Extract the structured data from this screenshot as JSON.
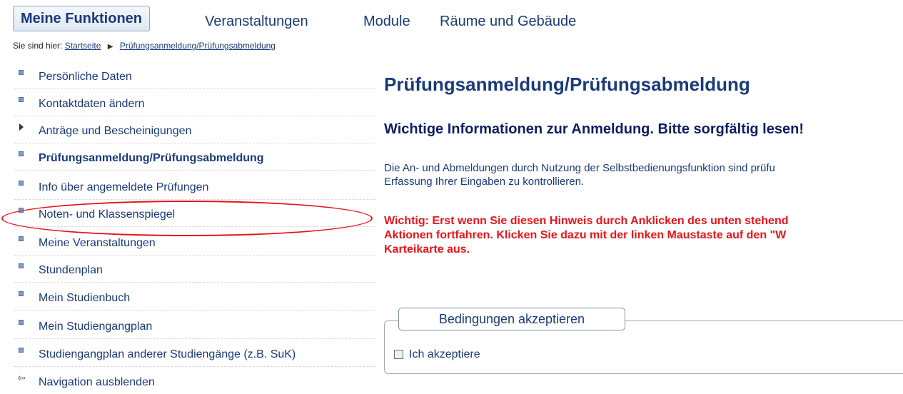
{
  "topnav": {
    "tabs": [
      {
        "label": "Meine Funktionen",
        "active": true
      },
      {
        "label": "Veranstaltungen"
      },
      {
        "label": "Module"
      },
      {
        "label": "Räume und Gebäude"
      }
    ]
  },
  "breadcrumb": {
    "prefix": "Sie sind hier:",
    "items": [
      "Startseite",
      "Prüfungsanmeldung/Prüfungsabmeldung"
    ]
  },
  "sidebar": {
    "items": [
      {
        "label": "Persönliche Daten",
        "icon": "square-bullet-icon"
      },
      {
        "label": "Kontaktdaten ändern",
        "icon": "square-bullet-icon"
      },
      {
        "label": "Anträge und Bescheinigungen",
        "icon": "triangle-right-icon"
      },
      {
        "label": "Prüfungsanmeldung/Prüfungsabmeldung",
        "icon": "square-bullet-icon",
        "active": true
      },
      {
        "label": "Info über angemeldete Prüfungen",
        "icon": "square-bullet-icon"
      },
      {
        "label": "Noten- und Klassenspiegel",
        "icon": "square-bullet-icon"
      },
      {
        "label": "Meine Veranstaltungen",
        "icon": "square-bullet-icon"
      },
      {
        "label": "Stundenplan",
        "icon": "square-bullet-icon"
      },
      {
        "label": "Mein Studienbuch",
        "icon": "square-bullet-icon"
      },
      {
        "label": "Mein Studiengangplan",
        "icon": "square-bullet-icon"
      },
      {
        "label": "Studiengangplan anderer Studiengänge (z.B. SuK)",
        "icon": "square-bullet-icon"
      },
      {
        "label": "Navigation ausblenden",
        "icon": "arrow-left-icon"
      }
    ]
  },
  "main": {
    "title": "Prüfungsanmeldung/Prüfungsabmeldung",
    "subtitle": "Wichtige Informationen zur Anmeldung. Bitte sorgfältig lesen!",
    "paragraph": [
      "Die An- und Abmeldungen durch Nutzung der Selbstbedienungsfunktion sind prüfu",
      "Erfassung Ihrer Eingaben zu kontrollieren."
    ],
    "warning": [
      "Wichtig: Erst wenn Sie diesen Hinweis durch Anklicken des unten stehend",
      "Aktionen fortfahren. Klicken Sie dazu mit der linken Maustaste auf den \"W",
      "Karteikarte aus."
    ],
    "conditions": {
      "legend": "Bedingungen akzeptieren",
      "checkbox_label": "Ich akzeptiere",
      "checked": false
    }
  },
  "colors": {
    "link": "#1a3a7a",
    "warning": "#e8141b",
    "highlight_oval": "#e4141b"
  }
}
